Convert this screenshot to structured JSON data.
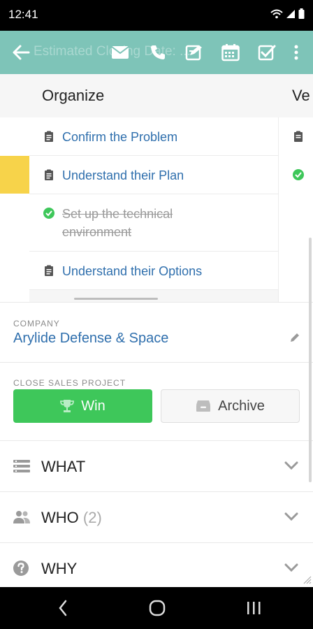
{
  "status_bar": {
    "time": "12:41"
  },
  "toolbar": {
    "ghost_title": "Estimated Closing Date: ...",
    "icons": [
      "back-arrow-icon",
      "email-icon",
      "phone-icon",
      "edit-note-icon",
      "calendar-icon",
      "checkbox-icon",
      "more-vertical-icon"
    ]
  },
  "board": {
    "columns": [
      {
        "title": "Organize"
      },
      {
        "title": "Ve"
      }
    ],
    "tasks": [
      {
        "label": "Confirm the Problem",
        "status": "open"
      },
      {
        "label": "Understand their Plan",
        "status": "open"
      },
      {
        "label": "Set up the technical environment",
        "status": "done"
      },
      {
        "label": "Understand their Options",
        "status": "open"
      }
    ]
  },
  "company": {
    "label": "COMPANY",
    "name": "Arylide Defense & Space"
  },
  "close_project": {
    "label": "CLOSE SALES PROJECT",
    "win_label": "Win",
    "archive_label": "Archive"
  },
  "sections": [
    {
      "title": "WHAT",
      "count": ""
    },
    {
      "title": "WHO",
      "count": "(2)"
    },
    {
      "title": "WHY",
      "count": ""
    }
  ],
  "colors": {
    "toolbar": "#7ec4b8",
    "link": "#2f6fad",
    "win": "#3ec75a",
    "accent_yellow": "#f7d34a"
  }
}
